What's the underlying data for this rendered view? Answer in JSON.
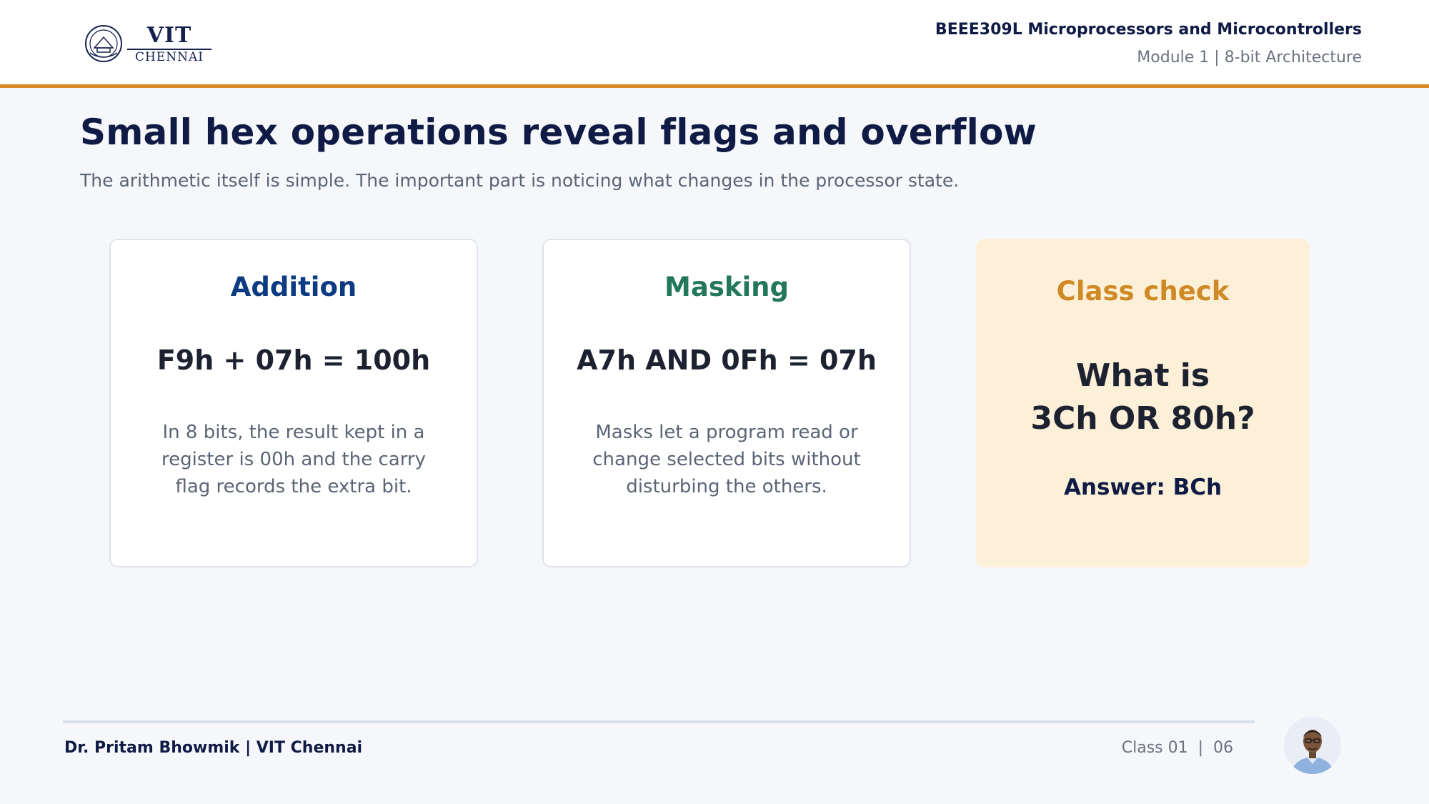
{
  "header": {
    "logo_text_top": "VIT",
    "logo_text_bottom": "CHENNAI",
    "course_title": "BEEE309L Microprocessors and Microcontrollers",
    "module_title": "Module 1 | 8-bit Architecture"
  },
  "main": {
    "title": "Small hex operations reveal flags and overflow",
    "subtitle": "The arithmetic itself is simple. The important part is noticing what changes in the processor state."
  },
  "cards": [
    {
      "heading": "Addition",
      "expression": "F9h + 07h = 100h",
      "description": "In 8 bits, the result kept in a register is 00h and the carry flag records the extra bit."
    },
    {
      "heading": "Masking",
      "expression": "A7h AND 0Fh = 07h",
      "description": "Masks let a program read or change selected bits without disturbing the others."
    }
  ],
  "check": {
    "heading": "Class check",
    "question_line1": "What is",
    "question_line2": "3Ch OR 80h?",
    "answer": "Answer: BCh"
  },
  "footer": {
    "author": "Dr. Pritam Bhowmik | VIT Chennai",
    "class_label": "Class 01  |  06"
  },
  "colors": {
    "accent": "#d98a22",
    "navy": "#0f1a45",
    "addition": "#0d3b82",
    "masking": "#23775c",
    "check_bg": "#fdf0d9"
  }
}
